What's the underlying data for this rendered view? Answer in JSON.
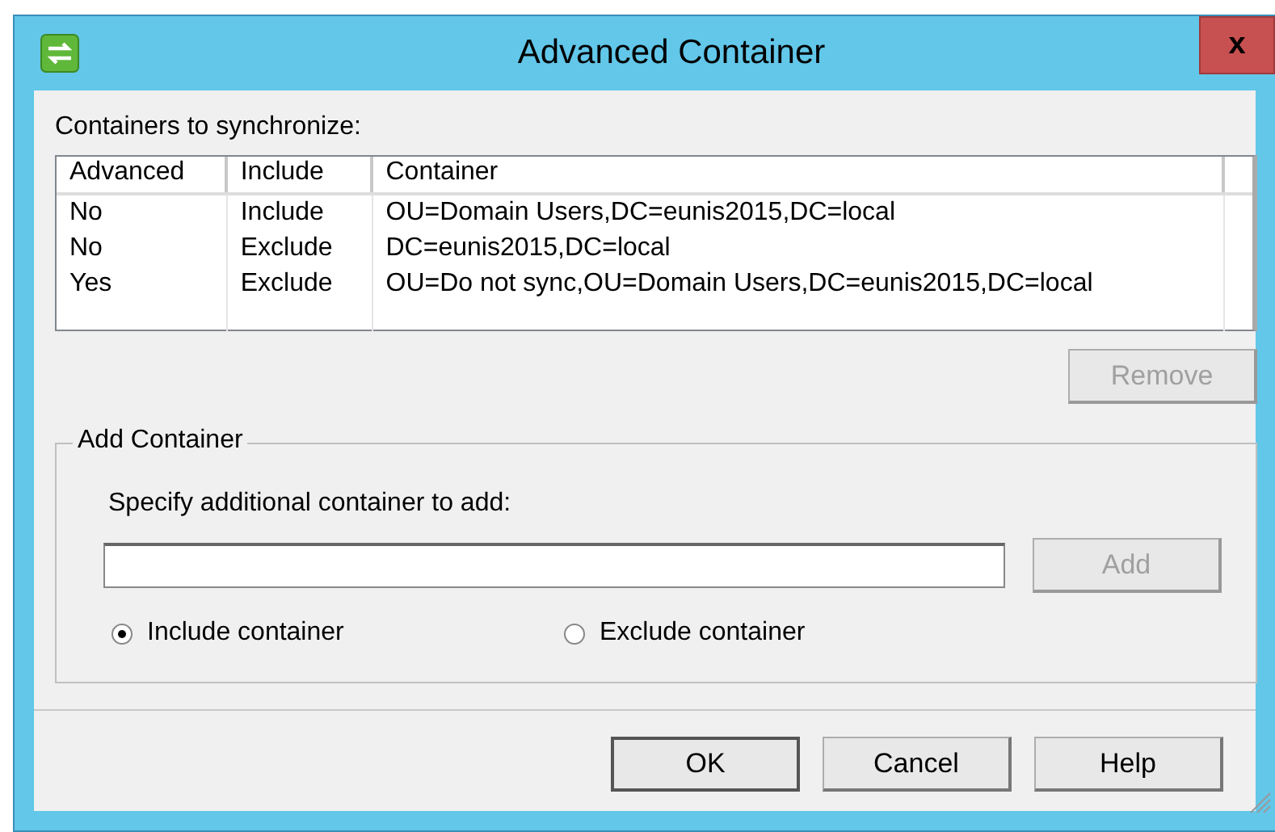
{
  "window": {
    "title": "Advanced Container",
    "close": "x"
  },
  "containers_label": "Containers to synchronize:",
  "table": {
    "columns": [
      "Advanced",
      "Include",
      "Container"
    ],
    "rows": [
      {
        "cells": [
          "No",
          "Include",
          "OU=Domain Users,DC=eunis2015,DC=local"
        ]
      },
      {
        "cells": [
          "No",
          "Exclude",
          "DC=eunis2015,DC=local"
        ]
      },
      {
        "cells": [
          "Yes",
          "Exclude",
          "OU=Do not sync,OU=Domain Users,DC=eunis2015,DC=local"
        ]
      }
    ]
  },
  "remove_button": {
    "label": "Remove",
    "disabled": true
  },
  "add_group": {
    "title": "Add Container",
    "prompt": "Specify additional container to add:",
    "add_button": {
      "label": "Add",
      "disabled": true
    },
    "options": [
      {
        "label": "Include container",
        "selected": true
      },
      {
        "label": "Exclude container",
        "selected": false
      }
    ]
  },
  "buttons": [
    {
      "label": "OK",
      "disabled": false,
      "default": true
    },
    {
      "label": "Cancel",
      "disabled": false,
      "default": false
    },
    {
      "label": "Help",
      "disabled": false,
      "default": false
    }
  ]
}
